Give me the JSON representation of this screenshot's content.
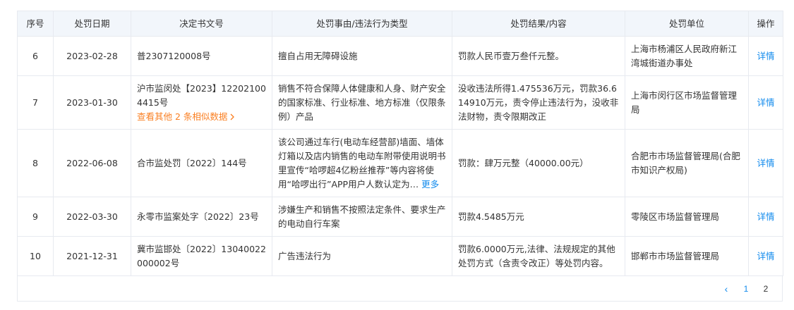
{
  "headers": {
    "no": "序号",
    "date": "处罚日期",
    "doc": "决定书文号",
    "reason": "处罚事由/违法行为类型",
    "result": "处罚结果/内容",
    "unit": "处罚单位",
    "op": "操作"
  },
  "rows": [
    {
      "no": "6",
      "date": "2023-02-28",
      "doc": "普2307120008号",
      "reason": "擅自占用无障碍设施",
      "result": "罚款人民币壹万叁仟元整。",
      "unit": "上海市杨浦区人民政府新江湾城街道办事处",
      "action": "详情"
    },
    {
      "no": "7",
      "date": "2023-01-30",
      "doc": "沪市监闵处【2023】122021004415号",
      "doc_similar": "查看其他 2 条相似数据",
      "doc_similar_icon": "chevron-right-icon",
      "reason": "销售不符合保障人体健康和人身、财产安全的国家标准、行业标准、地方标准（仅限条例）产品",
      "result": "没收违法所得1.475536万元，罚款36.614910万元，责令停止违法行为，没收非法财物，责令限期改正",
      "unit": "上海市闵行区市场监督管理局",
      "action": "详情"
    },
    {
      "no": "8",
      "date": "2022-06-08",
      "doc": "合市监处罚〔2022〕144号",
      "reason": "该公司通过车行(电动车经营部)墙面、墙体灯箱以及店内销售的电动车附带使用说明书里宣传“哈啰超4亿粉丝推荐”等内容将使用“哈啰出行”APP用户人数认定为",
      "reason_more": "更多",
      "result": "罚款：肆万元整（40000.00元）",
      "unit": "合肥市市场监督管理局(合肥市知识产权局)",
      "action": "详情"
    },
    {
      "no": "9",
      "date": "2022-03-30",
      "doc": "永零市监案处字〔2022〕23号",
      "reason": "涉嫌生产和销售不按照法定条件、要求生产的电动自行车案",
      "result": "罚款4.5485万元",
      "unit": "零陵区市场监督管理局",
      "action": "详情"
    },
    {
      "no": "10",
      "date": "2021-12-31",
      "doc": "冀市监邯处〔2022〕13040022000002号",
      "reason": "广告违法行为",
      "result": "罚款6.0000万元,法律、法规规定的其他处罚方式（含责令改正）等处罚内容。",
      "unit": "邯郸市市场监督管理局",
      "action": "详情"
    }
  ],
  "pagination": {
    "prev_icon": "chevron-left-icon",
    "prev_glyph": "‹",
    "pages": [
      "1",
      "2"
    ],
    "current": "2"
  }
}
